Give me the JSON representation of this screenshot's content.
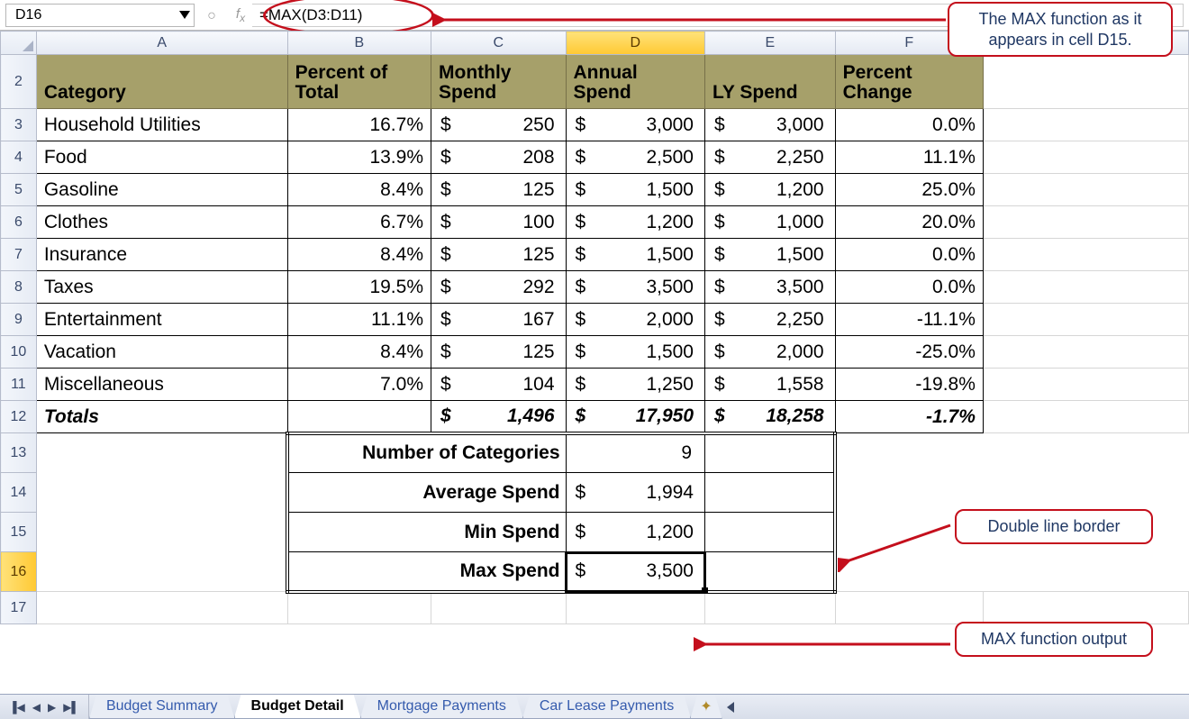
{
  "formula_bar": {
    "name_box": "D16",
    "formula": "=MAX(D3:D11)"
  },
  "columns": [
    "A",
    "B",
    "C",
    "D",
    "E",
    "F"
  ],
  "headers": {
    "A": "Category",
    "B": "Percent of Total",
    "C": "Monthly Spend",
    "D": "Annual Spend",
    "E": "LY Spend",
    "F": "Percent Change"
  },
  "rows": [
    {
      "n": 3,
      "cat": "Household Utilities",
      "pct": "16.7%",
      "mon": "250",
      "ann": "3,000",
      "ly": "3,000",
      "chg": "0.0%"
    },
    {
      "n": 4,
      "cat": "Food",
      "pct": "13.9%",
      "mon": "208",
      "ann": "2,500",
      "ly": "2,250",
      "chg": "11.1%"
    },
    {
      "n": 5,
      "cat": "Gasoline",
      "pct": "8.4%",
      "mon": "125",
      "ann": "1,500",
      "ly": "1,200",
      "chg": "25.0%"
    },
    {
      "n": 6,
      "cat": "Clothes",
      "pct": "6.7%",
      "mon": "100",
      "ann": "1,200",
      "ly": "1,000",
      "chg": "20.0%"
    },
    {
      "n": 7,
      "cat": "Insurance",
      "pct": "8.4%",
      "mon": "125",
      "ann": "1,500",
      "ly": "1,500",
      "chg": "0.0%"
    },
    {
      "n": 8,
      "cat": "Taxes",
      "pct": "19.5%",
      "mon": "292",
      "ann": "3,500",
      "ly": "3,500",
      "chg": "0.0%"
    },
    {
      "n": 9,
      "cat": "Entertainment",
      "pct": "11.1%",
      "mon": "167",
      "ann": "2,000",
      "ly": "2,250",
      "chg": "-11.1%"
    },
    {
      "n": 10,
      "cat": "Vacation",
      "pct": "8.4%",
      "mon": "125",
      "ann": "1,500",
      "ly": "2,000",
      "chg": "-25.0%"
    },
    {
      "n": 11,
      "cat": "Miscellaneous",
      "pct": "7.0%",
      "mon": "104",
      "ann": "1,250",
      "ly": "1,558",
      "chg": "-19.8%"
    }
  ],
  "totals": {
    "label": "Totals",
    "mon": "1,496",
    "ann": "17,950",
    "ly": "18,258",
    "chg": "-1.7%"
  },
  "summary": {
    "num_categories": {
      "label": "Number of Categories",
      "val": "9"
    },
    "avg": {
      "label": "Average Spend",
      "val": "1,994"
    },
    "min": {
      "label": "Min Spend",
      "val": "1,200"
    },
    "max": {
      "label": "Max Spend",
      "val": "3,500"
    }
  },
  "tabs": [
    "Budget Summary",
    "Budget Detail",
    "Mortgage Payments",
    "Car Lease Payments"
  ],
  "active_tab": "Budget Detail",
  "callouts": {
    "c1": "The MAX function as it appears in cell D15.",
    "c2": "Double line border",
    "c3": "MAX function output"
  },
  "row_numbers": {
    "r2": "2",
    "r3": "3",
    "r4": "4",
    "r5": "5",
    "r6": "6",
    "r7": "7",
    "r8": "8",
    "r9": "9",
    "r10": "10",
    "r11": "11",
    "r12": "12",
    "r13": "13",
    "r14": "14",
    "r15": "15",
    "r16": "16",
    "r17": "17"
  },
  "currency": "$"
}
